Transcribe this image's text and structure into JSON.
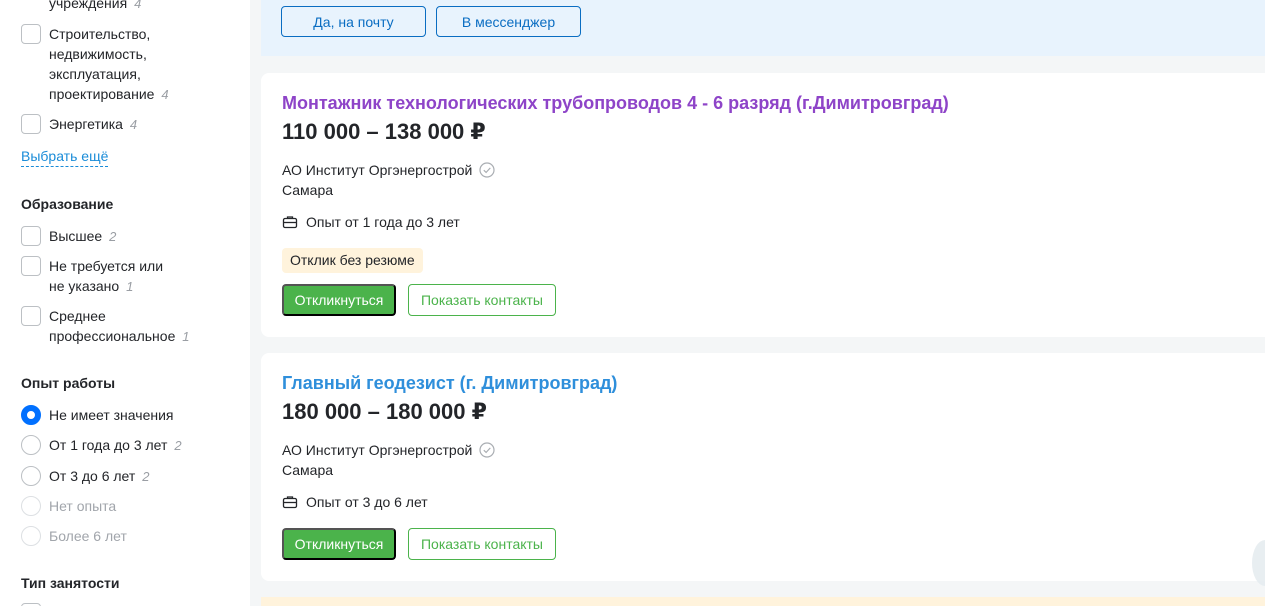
{
  "sidebar": {
    "industry_items": [
      {
        "label": "учреждения",
        "count": "4"
      },
      {
        "label_lines": [
          "Строительство,",
          "недвижимость,",
          "эксплуатация,",
          "проектирование"
        ],
        "count": "4"
      },
      {
        "label": "Энергетика",
        "count": "4"
      }
    ],
    "more_link": "Выбрать ещё",
    "education": {
      "title": "Образование",
      "items": [
        {
          "label": "Высшее",
          "count": "2"
        },
        {
          "label_lines": [
            "Не требуется или",
            "не указано"
          ],
          "count": "1"
        },
        {
          "label_lines": [
            "Среднее",
            "профессиональное"
          ],
          "count": "1"
        }
      ]
    },
    "experience": {
      "title": "Опыт работы",
      "items": [
        {
          "label": "Не имеет значения",
          "count": "",
          "checked": true,
          "disabled": false
        },
        {
          "label": "От 1 года до 3 лет",
          "count": "2",
          "checked": false,
          "disabled": false
        },
        {
          "label": "От 3 до 6 лет",
          "count": "2",
          "checked": false,
          "disabled": false
        },
        {
          "label": "Нет опыта",
          "count": "",
          "checked": false,
          "disabled": true
        },
        {
          "label": "Более 6 лет",
          "count": "",
          "checked": false,
          "disabled": true
        }
      ]
    },
    "employment": {
      "title": "Тип занятости"
    }
  },
  "notice": {
    "email_button": "Да, на почту",
    "messenger_button": "В мессенджер"
  },
  "vacancies": [
    {
      "title": "Монтажник технологических трубопроводов 4 - 6 разряд (г.Димитровград)",
      "title_color": "#8e44c8",
      "salary": "110 000 – 138 000 ₽",
      "company": "АО Институт Оргэнергострой",
      "city": "Самара",
      "experience": "Опыт от 1 года до 3 лет",
      "badge": "Отклик без резюме",
      "apply_button": "Откликнуться",
      "contacts_button": "Показать контакты"
    },
    {
      "title": "Главный геодезист (г. Димитровград)",
      "title_color": "#2f8fdb",
      "salary": "180 000 – 180 000 ₽",
      "company": "АО Институт Оргэнергострой",
      "city": "Самара",
      "experience": "Опыт от 3 до 6 лет",
      "apply_button": "Откликнуться",
      "contacts_button": "Показать контакты"
    }
  ],
  "colors": {
    "accent_green": "#4bb34b",
    "link_blue": "#1a8cd8",
    "radio_blue": "#0070ff",
    "visited_title": "#8e44c8",
    "title_blue": "#2f8fdb"
  },
  "icons": [
    "checkbox",
    "radio",
    "verified-check-icon",
    "briefcase-icon"
  ]
}
